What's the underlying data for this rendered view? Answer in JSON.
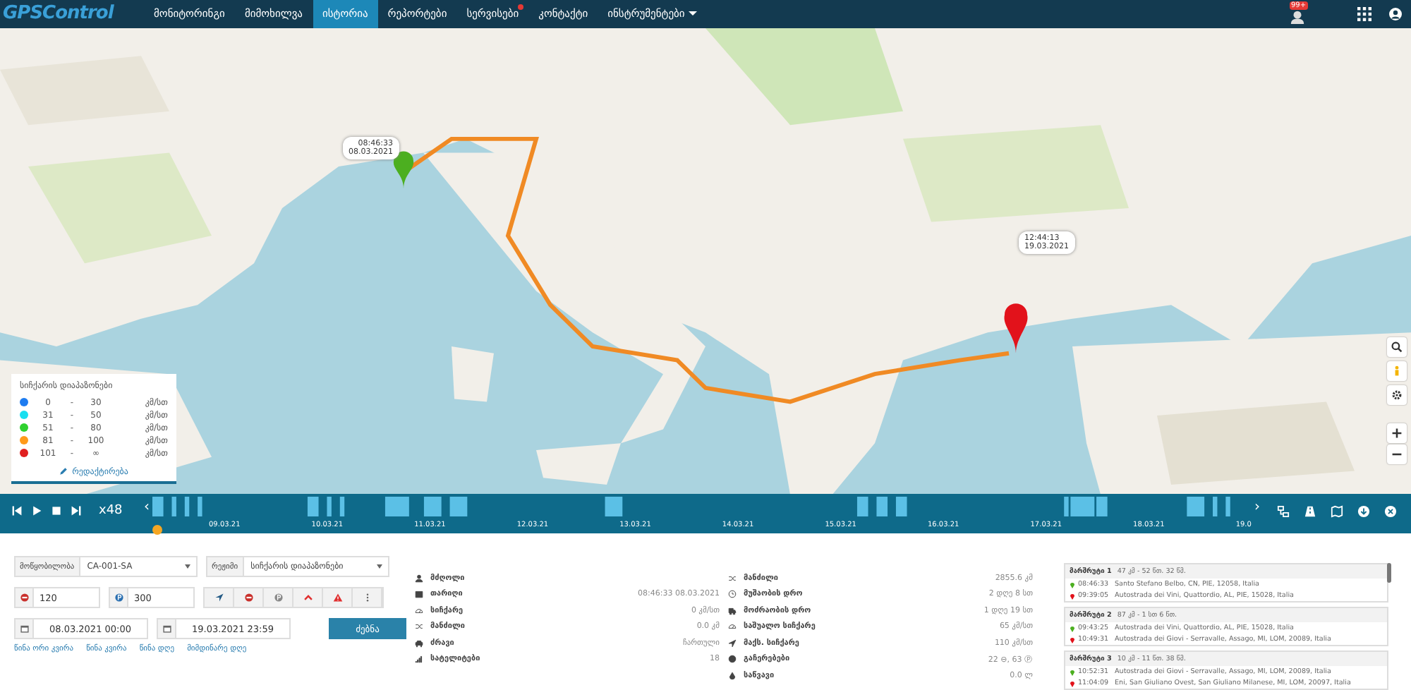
{
  "nav": {
    "logo": "GPSControl",
    "notification_count": "99+",
    "items": [
      {
        "label": "მონიტორინგი",
        "selected": false,
        "alert": false,
        "dropdown": false
      },
      {
        "label": "მიმოხილვა",
        "selected": false,
        "alert": false,
        "dropdown": false
      },
      {
        "label": "ისტორია",
        "selected": true,
        "alert": false,
        "dropdown": false
      },
      {
        "label": "რეპორტები",
        "selected": false,
        "alert": false,
        "dropdown": false
      },
      {
        "label": "სერვისები",
        "selected": false,
        "alert": true,
        "dropdown": false
      },
      {
        "label": "კონტაქტი",
        "selected": false,
        "alert": false,
        "dropdown": false
      },
      {
        "label": "ინსტრუმენტები",
        "selected": false,
        "alert": false,
        "dropdown": true
      }
    ]
  },
  "map": {
    "markers": [
      {
        "kind": "start",
        "time": "08:46:33",
        "date": "08.03.2021"
      },
      {
        "kind": "end",
        "time": "12:44:13",
        "date": "19.03.2021"
      }
    ]
  },
  "speed_legend": {
    "title": "სიჩქარის დიაპაზონები",
    "edit_link": "რედაქტირება",
    "ranges": [
      {
        "from": "0",
        "sep": "-",
        "to": "30",
        "unit": "კმ/სთ",
        "color": "#1e7cf0"
      },
      {
        "from": "31",
        "sep": "-",
        "to": "50",
        "unit": "კმ/სთ",
        "color": "#18dff0"
      },
      {
        "from": "51",
        "sep": "-",
        "to": "80",
        "unit": "კმ/სთ",
        "color": "#2fd12f"
      },
      {
        "from": "81",
        "sep": "-",
        "to": "100",
        "unit": "კმ/სთ",
        "color": "#ff9a1a"
      },
      {
        "from": "101",
        "sep": "-",
        "to": "∞",
        "unit": "კმ/სთ",
        "color": "#e02020"
      }
    ]
  },
  "playback": {
    "speed": "x48",
    "prev": "‹",
    "next": "›",
    "dates": [
      "09.03.21",
      "10.03.21",
      "11.03.21",
      "12.03.21",
      "13.03.21",
      "14.03.21",
      "15.03.21",
      "16.03.21",
      "17.03.21",
      "18.03.21",
      "19.0"
    ]
  },
  "filters": {
    "device": {
      "label": "მოწყობილობა",
      "value": "CA-001-SA"
    },
    "mode": {
      "label": "რეჟიმი",
      "value": "სიჩქარის დიაპაზონები"
    },
    "stop_minutes": "120",
    "parking_minutes": "300",
    "date_from": "08.03.2021 00:00",
    "date_to": "19.03.2021 23:59",
    "search_button": "ძებნა",
    "quick_links": [
      "წინა ორი კვირა",
      "წინა კვირა",
      "წინა დღე",
      "მიმდინარე დღე"
    ]
  },
  "stats_left": [
    {
      "label": "მძღოლი"
    },
    {
      "label": "თარიღი",
      "value": "08:46:33 08.03.2021"
    },
    {
      "label": "სიჩქარე",
      "value": "0 კმ/სთ"
    },
    {
      "label": "მანძილი",
      "value": "0.0 კმ"
    },
    {
      "label": "ძრავი",
      "value": "ჩართული"
    },
    {
      "label": "სატელიტები",
      "value": "18"
    }
  ],
  "stats_right": [
    {
      "label": "მანძილი",
      "value": "2855.6 კმ"
    },
    {
      "label": "მუშაობის დრო",
      "value": "2 დღე 8 სთ"
    },
    {
      "label": "მოძრაობის დრო",
      "value": "1 დღე 19 სთ"
    },
    {
      "label": "საშუალო სიჩქარე",
      "value": "65 კმ/სთ"
    },
    {
      "label": "მაქს. სიჩქარე",
      "value": "110 კმ/სთ"
    },
    {
      "label": "გაჩერებები",
      "value": "22 ⊖, 63 Ⓟ"
    },
    {
      "label": "საწვავი",
      "value": "0.0 ლ"
    }
  ],
  "trips": [
    {
      "title": "მარშრუტი 1",
      "summary": "47 კმ - 52 წთ. 32 წმ.",
      "start": {
        "time": "08:46:33",
        "address": "Santo Stefano Belbo, CN, PIE, 12058, Italia"
      },
      "end": {
        "time": "09:39:05",
        "address": "Autostrada dei Vini, Quattordio, AL, PIE, 15028, Italia"
      }
    },
    {
      "title": "მარშრუტი 2",
      "summary": "87 კმ - 1 სთ 6 წთ.",
      "start": {
        "time": "09:43:25",
        "address": "Autostrada dei Vini, Quattordio, AL, PIE, 15028, Italia"
      },
      "end": {
        "time": "10:49:31",
        "address": "Autostrada dei Giovi - Serravalle, Assago, MI, LOM, 20089, Italia"
      }
    },
    {
      "title": "მარშრუტი 3",
      "summary": "10 კმ - 11 წთ. 38 წმ.",
      "start": {
        "time": "10:52:31",
        "address": "Autostrada dei Giovi - Serravalle, Assago, MI, LOM, 20089, Italia"
      },
      "end": {
        "time": "11:04:09",
        "address": "Eni, San Giuliano Ovest, San Giuliano Milanese, MI, LOM, 20097, Italia"
      }
    }
  ]
}
